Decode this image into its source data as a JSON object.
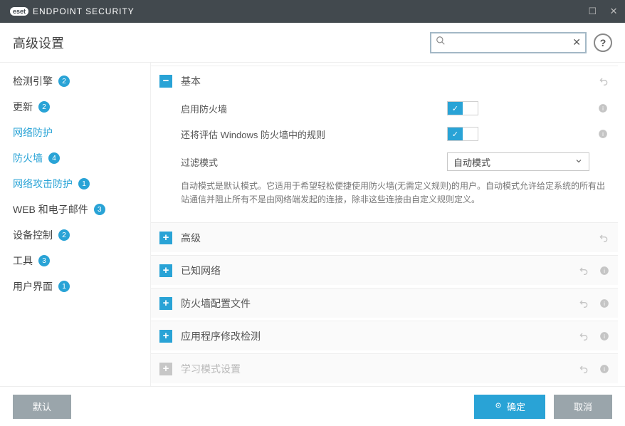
{
  "titlebar": {
    "brand_badge": "eset",
    "brand_text": "ENDPOINT SECURITY"
  },
  "header": {
    "title": "高级设置",
    "help": "?"
  },
  "search": {
    "placeholder": ""
  },
  "sidebar": [
    {
      "label": "检测引擎",
      "badge": "2"
    },
    {
      "label": "更新",
      "badge": "2"
    },
    {
      "label": "网络防护",
      "highlight": true
    },
    {
      "label": "防火墙",
      "badge": "4",
      "active": true,
      "child": true
    },
    {
      "label": "网络攻击防护",
      "badge": "1",
      "highlight": true,
      "child": true
    },
    {
      "label": "WEB 和电子邮件",
      "badge": "3"
    },
    {
      "label": "设备控制",
      "badge": "2"
    },
    {
      "label": "工具",
      "badge": "3"
    },
    {
      "label": "用户界面",
      "badge": "1"
    }
  ],
  "sections": {
    "basic": {
      "title": "基本",
      "expanded": true
    },
    "advanced": {
      "title": "高级"
    },
    "known": {
      "title": "已知网络"
    },
    "profiles": {
      "title": "防火墙配置文件"
    },
    "appmod": {
      "title": "应用程序修改检测"
    },
    "learn": {
      "title": "学习模式设置",
      "disabled": true
    }
  },
  "settings": {
    "enable_fw": {
      "label": "启用防火墙",
      "on": true
    },
    "eval_winfw": {
      "label": "还将评估 Windows 防火墙中的规则",
      "on": true
    },
    "filter_mode": {
      "label": "过滤模式",
      "value": "自动模式"
    },
    "filter_desc": "自动模式是默认模式。它适用于希望轻松便捷使用防火墙(无需定义规则)的用户。自动模式允许给定系统的所有出站通信并阻止所有不是由网络端发起的连接，除非这些连接由自定义规则定义。"
  },
  "footer": {
    "default": "默认",
    "ok": "确定",
    "cancel": "取消"
  }
}
